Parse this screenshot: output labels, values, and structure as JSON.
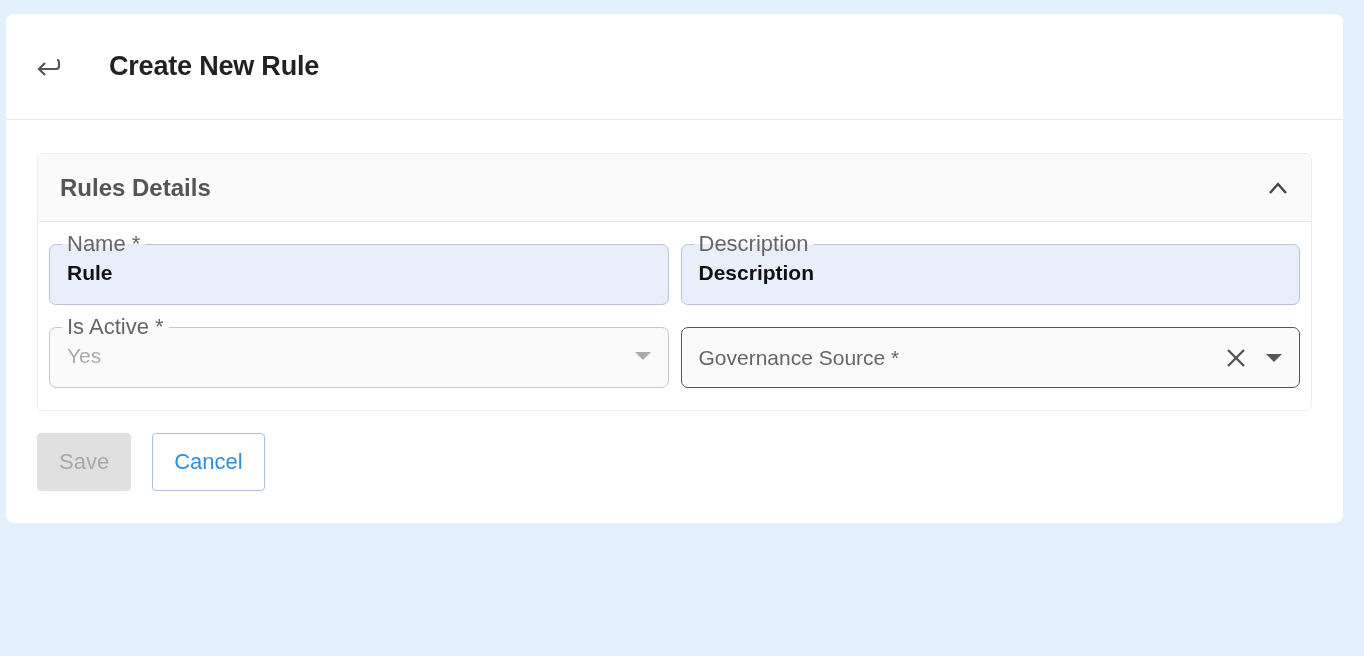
{
  "page": {
    "title": "Create New Rule"
  },
  "section": {
    "title": "Rules Details",
    "expanded": true,
    "fields": [
      {
        "kind": "text",
        "label": "Name *",
        "value": "Rule",
        "autofilled": true,
        "disabled": false,
        "clearable": false
      },
      {
        "kind": "text",
        "label": "Description",
        "value": "Description",
        "autofilled": true,
        "disabled": false,
        "clearable": false
      },
      {
        "kind": "select",
        "label": "Is Active *",
        "value": "Yes",
        "autofilled": false,
        "disabled": true,
        "clearable": false
      },
      {
        "kind": "select",
        "label": "Governance Source *",
        "autofilled": false,
        "disabled": false,
        "clearable": true
      }
    ]
  },
  "buttons": [
    {
      "kind": "primary",
      "label": "Save",
      "disabled": true
    },
    {
      "kind": "outlined",
      "label": "Cancel",
      "disabled": false
    }
  ]
}
